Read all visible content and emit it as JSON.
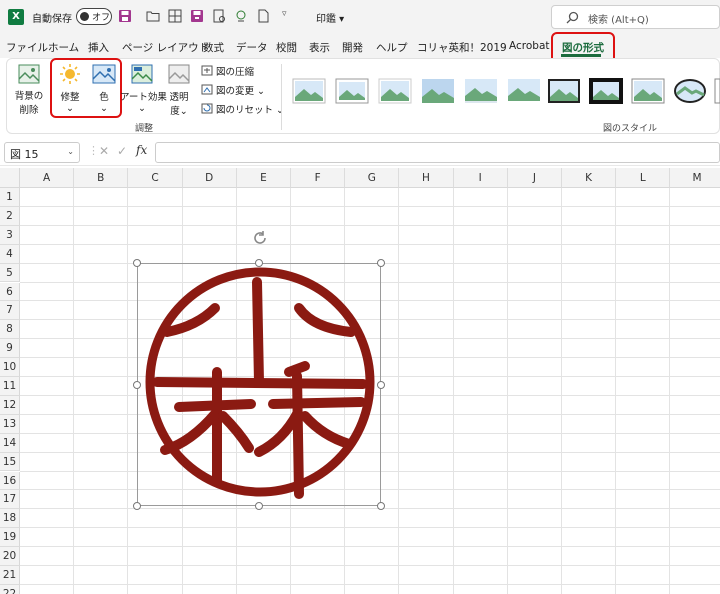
{
  "titlebar": {
    "autosave_label": "自動保存",
    "autosave_state": "オフ",
    "print_label": "印鑑",
    "search_placeholder": "検索 (Alt+Q)"
  },
  "tabs": [
    {
      "label": "ファイル"
    },
    {
      "label": "ホーム"
    },
    {
      "label": "挿入"
    },
    {
      "label": "ページ レイアウト"
    },
    {
      "label": "数式"
    },
    {
      "label": "データ"
    },
    {
      "label": "校閲"
    },
    {
      "label": "表示"
    },
    {
      "label": "開発"
    },
    {
      "label": "ヘルプ"
    },
    {
      "label": "コリャ英和！2019"
    },
    {
      "label": "Acrobat"
    },
    {
      "label": "図の形式",
      "active": true
    }
  ],
  "ribbon": {
    "remove_bg_line1": "背景の",
    "remove_bg_line2": "削除",
    "corrections": "修整",
    "color": "色",
    "artistic": "アート効果",
    "transparency_line1": "透明",
    "transparency_line2": "度",
    "compress": "図の圧縮",
    "change": "図の変更",
    "reset": "図のリセット",
    "adjust_group": "調整",
    "styles_group": "図のスタイル"
  },
  "formula_bar": {
    "name_box": "図 15",
    "cancel": "✕",
    "confirm": "✓",
    "fx": "fx",
    "value": ""
  },
  "grid": {
    "columns": [
      "A",
      "B",
      "C",
      "D",
      "E",
      "F",
      "G",
      "H",
      "I",
      "J",
      "K",
      "L",
      "M"
    ],
    "rows": [
      "1",
      "2",
      "3",
      "4",
      "5",
      "6",
      "7",
      "8",
      "9",
      "10",
      "11",
      "12",
      "13",
      "14",
      "15",
      "16",
      "17",
      "18",
      "19",
      "20",
      "21",
      "22"
    ]
  },
  "image": {
    "kind": "seal-stamp",
    "seal_text": "小林",
    "ink_color": "#8b1a12"
  },
  "colors": {
    "accent_green": "#1b6b3d",
    "highlight_red": "#dd1111"
  }
}
